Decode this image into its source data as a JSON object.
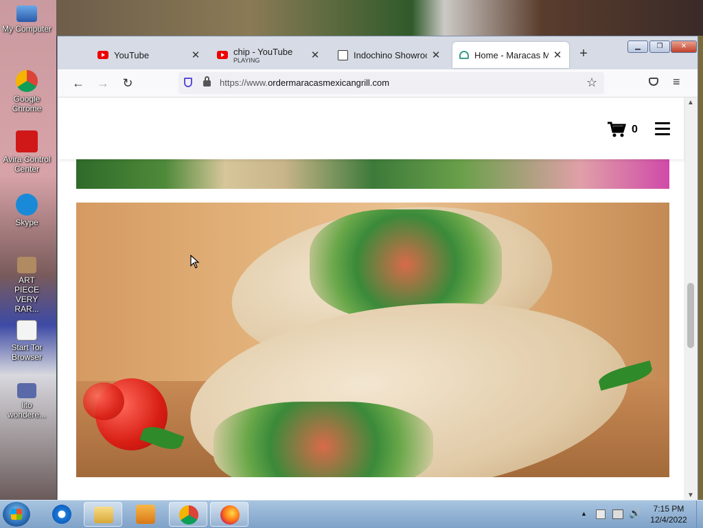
{
  "desktop": {
    "icons": [
      {
        "label": "My Computer"
      },
      {
        "label": "Google Chrome"
      },
      {
        "label": "Avira Control Center"
      },
      {
        "label": "Skype"
      },
      {
        "label": "ART PIECE VERY RAR..."
      },
      {
        "label": "Start Tor Browser"
      },
      {
        "label": "lito wondere..."
      }
    ]
  },
  "browser": {
    "tabs": [
      {
        "label": "YouTube",
        "sub": ""
      },
      {
        "label": "chip - YouTube",
        "sub": "PLAYING"
      },
      {
        "label": "Indochino Showroom:",
        "sub": ""
      },
      {
        "label": "Home - Maracas Mexi",
        "sub": ""
      }
    ],
    "url": {
      "prefix": "https://www.",
      "domain": "ordermaracasmexicangrill.com"
    }
  },
  "site": {
    "cart_count": "0"
  },
  "taskbar": {
    "time": "7:15 PM",
    "date": "12/4/2022"
  },
  "colors": {
    "youtube_red": "#e00000",
    "taskbar_blue": "#8fb0d4"
  }
}
